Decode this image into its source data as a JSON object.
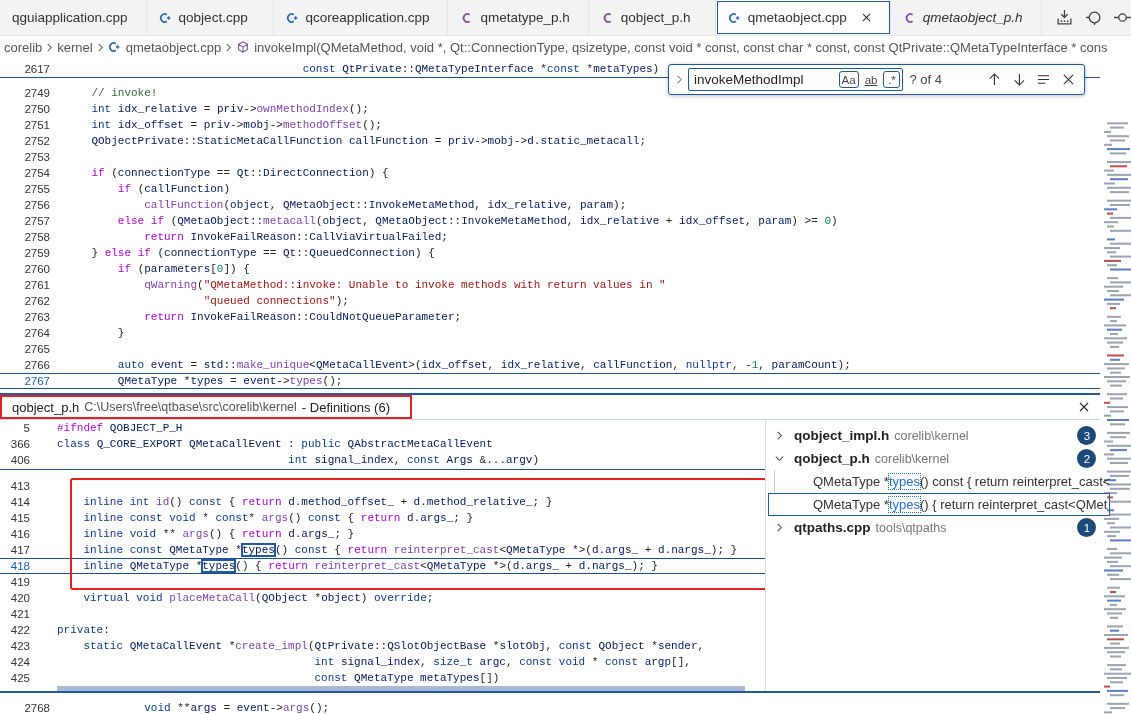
{
  "tabs": [
    {
      "label": "qguiapplication.cpp",
      "selected": false,
      "preview": false
    },
    {
      "label": "qobject.cpp",
      "kind": "cpp",
      "selected": false,
      "preview": false
    },
    {
      "label": "qcoreapplication.cpp",
      "kind": "cpp",
      "selected": false,
      "preview": false
    },
    {
      "label": "qmetatype_p.h",
      "kind": "header",
      "selected": false,
      "preview": false
    },
    {
      "label": "qobject_p.h",
      "kind": "header",
      "selected": false,
      "preview": false
    },
    {
      "label": "qmetaobject.cpp",
      "kind": "cpp",
      "selected": true,
      "preview": false
    },
    {
      "label": "qmetaobject_p.h",
      "kind": "header",
      "selected": false,
      "preview": true
    }
  ],
  "breadcrumb": [
    {
      "label": "corelib",
      "kind": "folder"
    },
    {
      "label": "kernel",
      "kind": "folder"
    },
    {
      "label": "qmetaobject.cpp",
      "kind": "cpp"
    },
    {
      "label": "invokeImpl(QMetaMethod, void *, Qt::ConnectionType, qsizetype, const void * const, const char * const, const QtPrivate::QMetaTypeInterface * cons",
      "kind": "method"
    }
  ],
  "sticky": [
    {
      "num": "2617",
      "text": "                                    const QtPrivate::QMetaTypeInterface *const *metaTypes)"
    }
  ],
  "find": {
    "value": "invokeMethodImpl",
    "options": [
      {
        "label": "Aa",
        "on": true
      },
      {
        "label": "ab",
        "on": false
      },
      {
        "label": ".*",
        "on": true
      }
    ],
    "count": "? of 4"
  },
  "lines": [
    {
      "num": "2749",
      "text": "    // invoke!",
      "current": false
    },
    {
      "num": "2750",
      "text": "    int idx_relative = priv->ownMethodIndex();",
      "current": false
    },
    {
      "num": "2751",
      "text": "    int idx_offset = priv->mobj->methodOffset();",
      "current": false
    },
    {
      "num": "2752",
      "text": "    QObjectPrivate::StaticMetaCallFunction callFunction = priv->mobj->d.static_metacall;",
      "current": false
    },
    {
      "num": "2753",
      "current": false
    },
    {
      "num": "2754",
      "text": "    if (connectionType == Qt::DirectConnection) {",
      "current": false
    },
    {
      "num": "2755",
      "text": "        if (callFunction)",
      "current": false
    },
    {
      "num": "2756",
      "text": "            callFunction(object, QMetaObject::InvokeMetaMethod, idx_relative, param);",
      "current": false
    },
    {
      "num": "2757",
      "text": "        else if (QMetaObject::metacall(object, QMetaObject::InvokeMetaMethod, idx_relative + idx_offset, param) >= 0)",
      "current": false
    },
    {
      "num": "2758",
      "text": "            return InvokeFailReason::CallViaVirtualFailed;",
      "current": false
    },
    {
      "num": "2759",
      "text": "    } else if (connectionType == Qt::QueuedConnection) {",
      "current": false
    },
    {
      "num": "2760",
      "text": "        if (parameters[0]) {",
      "current": false
    },
    {
      "num": "2761",
      "text": "            qWarning(\"QMetaMethod::invoke: Unable to invoke methods with return values in \"",
      "current": false
    },
    {
      "num": "2762",
      "text": "                     \"queued connections\");",
      "current": false
    },
    {
      "num": "2763",
      "text": "            return InvokeFailReason::CouldNotQueueParameter;",
      "current": false
    },
    {
      "num": "2764",
      "text": "        }",
      "current": false
    },
    {
      "num": "2765",
      "current": false
    },
    {
      "num": "2766",
      "text": "        auto event = std::make_unique<QMetaCallEvent>(idx_offset, idx_relative, callFunction, nullptr, -1, paramCount);",
      "current": false
    },
    {
      "num": "2767",
      "text": "        QMetaType *types = event->types();",
      "current": true
    }
  ],
  "peek": {
    "file": "qobject_p.h",
    "path": "C:\\Users\\free\\qtbase\\src\\corelib\\kernel",
    "title": "- Definitions (6)",
    "title_boxed": true,
    "sticky": [
      {
        "num": "5",
        "text": "#ifndef QOBJECT_P_H"
      },
      {
        "num": "366",
        "text": "class Q_CORE_EXPORT QMetaCallEvent : public QAbstractMetaCallEvent"
      },
      {
        "num": "406",
        "text": "                                   int signal_index, const Args &...argv)"
      }
    ],
    "lines": [
      {
        "num": "413",
        "current": false,
        "boxed": true
      },
      {
        "num": "414",
        "text": "    inline int id() const { return d.method_offset_ + d.method_relative_; }",
        "current": false,
        "boxed": true
      },
      {
        "num": "415",
        "text": "    inline const void * const* args() const { return d.args_; }",
        "current": false,
        "boxed": true
      },
      {
        "num": "416",
        "text": "    inline void ** args() { return d.args_; }",
        "current": false,
        "boxed": true
      },
      {
        "num": "417",
        "segments": [
          {
            "text": "    inline const QMetaType *",
            "match": false
          },
          {
            "text": "types",
            "match": true
          },
          {
            "text": "() const { return reinterpret_cast<QMetaType *>(d.args_ + d.nargs_); }",
            "match": false
          }
        ],
        "current": false,
        "boxed": true
      },
      {
        "num": "418",
        "segments": [
          {
            "text": "    inline QMetaType *",
            "match": false
          },
          {
            "text": "types",
            "match": true
          },
          {
            "text": "() { return reinterpret_cast<QMetaType *>(d.args_ + d.nargs_); }",
            "match": false
          }
        ],
        "current": true,
        "boxed": true
      },
      {
        "num": "419",
        "current": false,
        "boxed": true
      },
      {
        "num": "420",
        "text": "    virtual void placeMetaCall(QObject *object) override;",
        "current": false,
        "boxed": false
      },
      {
        "num": "421",
        "current": false,
        "boxed": false
      },
      {
        "num": "422",
        "text": "private:",
        "current": false,
        "boxed": false
      },
      {
        "num": "423",
        "text": "    static QMetaCallEvent *create_impl(QtPrivate::QSlotObjectBase *slotObj, const QObject *sender,",
        "current": false,
        "boxed": false
      },
      {
        "num": "424",
        "text": "                                       int signal_index, size_t argc, const void * const argp[],",
        "current": false,
        "boxed": false
      },
      {
        "num": "425",
        "text": "                                       const QMetaType metaTypes[])",
        "current": false,
        "boxed": false
      }
    ],
    "references": [
      {
        "file": "qobject_impl.h",
        "dir": "corelib\\kernel",
        "count": "3",
        "expanded": false
      },
      {
        "file": "qobject_p.h",
        "dir": "corelib\\kernel",
        "count": "2",
        "expanded": true,
        "children": [
          {
            "before": "QMetaType *",
            "match": "types",
            "after": "() const { return reinterpret_cast<",
            "selected": false
          },
          {
            "before": "QMetaType *",
            "match": "types",
            "after": "() { return reinterpret_cast<QMet",
            "selected": true
          }
        ]
      },
      {
        "file": "qtpaths.cpp",
        "dir": "tools\\qtpaths",
        "count": "1",
        "expanded": false
      }
    ]
  },
  "bottom_lines": [
    {
      "num": "2768",
      "text": "            void **args = event->args();"
    }
  ]
}
